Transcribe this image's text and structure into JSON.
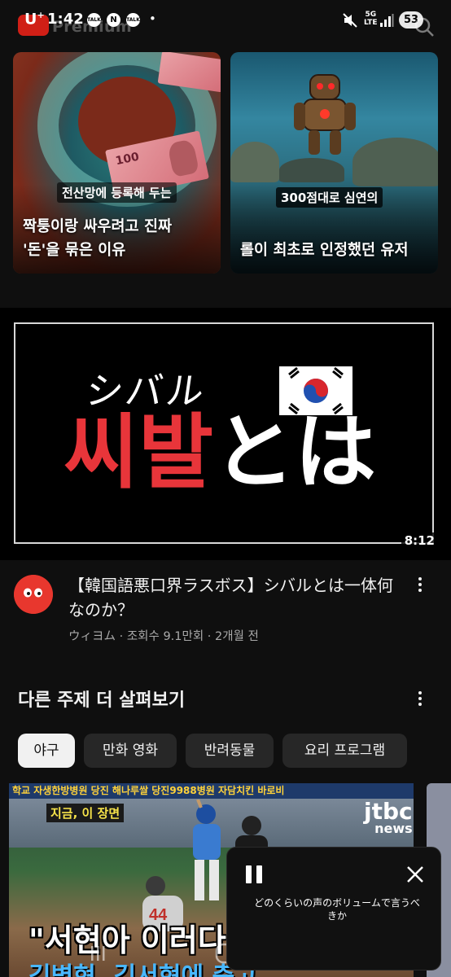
{
  "status_bar": {
    "carrier": "U",
    "carrier_sup": "+",
    "time": "1:42",
    "notification_icons": [
      "TALK",
      "N",
      "TALK"
    ],
    "network": "5G",
    "network_sub": "LTE",
    "battery": "53",
    "app_name": "Premium"
  },
  "shorts": [
    {
      "overlay_tag": "전산망에 등록해 두는",
      "title_line1": "짝퉁이랑 싸우려고 진짜",
      "title_line2": "'돈'을 묶은 이유",
      "banknote_value": "100"
    },
    {
      "overlay_tag": "300점대로 심연의",
      "title_line1": "롤이 최초로 인정했던 유저"
    }
  ],
  "main_video": {
    "thumbnail_katakana": "シバル",
    "thumbnail_hangul": "씨발",
    "thumbnail_hiragana": "とは",
    "duration": "8:12",
    "title": "【韓国語悪口界ラスボス】シバルとは一体何なのか？",
    "channel": "ウィヨム",
    "views": "조회수 9.1만회",
    "age": "2개월 전",
    "subtitle": "ウィヨム · 조회수 9.1만회 · 2개월 전"
  },
  "explore": {
    "heading": "다른 주제 더 살펴보기",
    "chips": [
      "야구",
      "만화 영화",
      "반려동물",
      "요리 프로그램"
    ],
    "active_chip": "야구"
  },
  "bottom_video": {
    "ad_strip": "학교 자생한방병원 당진 해나루쌀 당진9988병원 자담치킨 바로비",
    "tag": "지금, 이 장면",
    "brand": "jtbc",
    "brand_sub": "news",
    "caption_line1": "\"서현아 이러다",
    "caption_line2": "김병현, 김서현에 충고"
  },
  "mini_player": {
    "caption": "どのくらいの声のボリュームで言うべきか"
  },
  "colors": {
    "background": "#0f0f0f",
    "chip": "#272727",
    "chip_active": "#f1f1f1",
    "accent_red": "#e8353a"
  }
}
